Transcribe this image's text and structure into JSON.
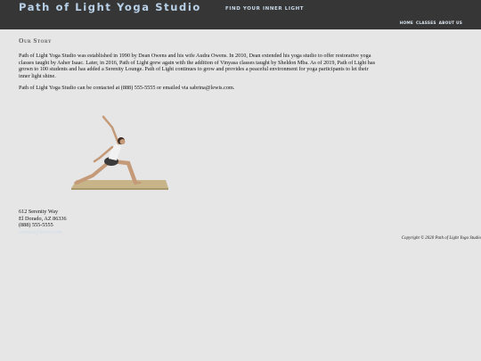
{
  "header": {
    "site_title": "Path of Light Yoga Studio",
    "tagline": "FIND YOUR INNER LIGHT",
    "nav": {
      "home": "HOME",
      "classes": "CLASSES",
      "about": "ABOUT US"
    }
  },
  "main": {
    "section_title": "Our Story",
    "paragraph_1": "Path of Light Yoga Studio was established in 1990 by Dean Owens and his wife Audra Owens. In 2010, Dean extended his yoga studio to offer restorative yoga classes taught by Asher Isaac. Later, in 2016, Path of Light grew again with the addition of Vinyasa classes taught by Sheldon Mba. As of 2019, Path of Light has grown to 100 students and has added a Serenity Lounge. Path of Light continues to grow and provides a peaceful environment for yoga participants to let their inner light shine.",
    "paragraph_2": "Path of Light Yoga Studio can be contacted at (888) 555-5555 or emailed via sabrina@lewis.com."
  },
  "contact": {
    "street": "612 Serenity Way",
    "city": "El Dorado, AZ 86336",
    "phone": "(888) 555-5555",
    "email": "sabrina@lewis.com"
  },
  "footer": {
    "copyright": "Copyright © 2020 Path of Light Yoga Studio"
  },
  "colors": {
    "header_bg": "#363636",
    "page_bg": "#e6e6e6",
    "title_accent": "#b9d1e8"
  }
}
